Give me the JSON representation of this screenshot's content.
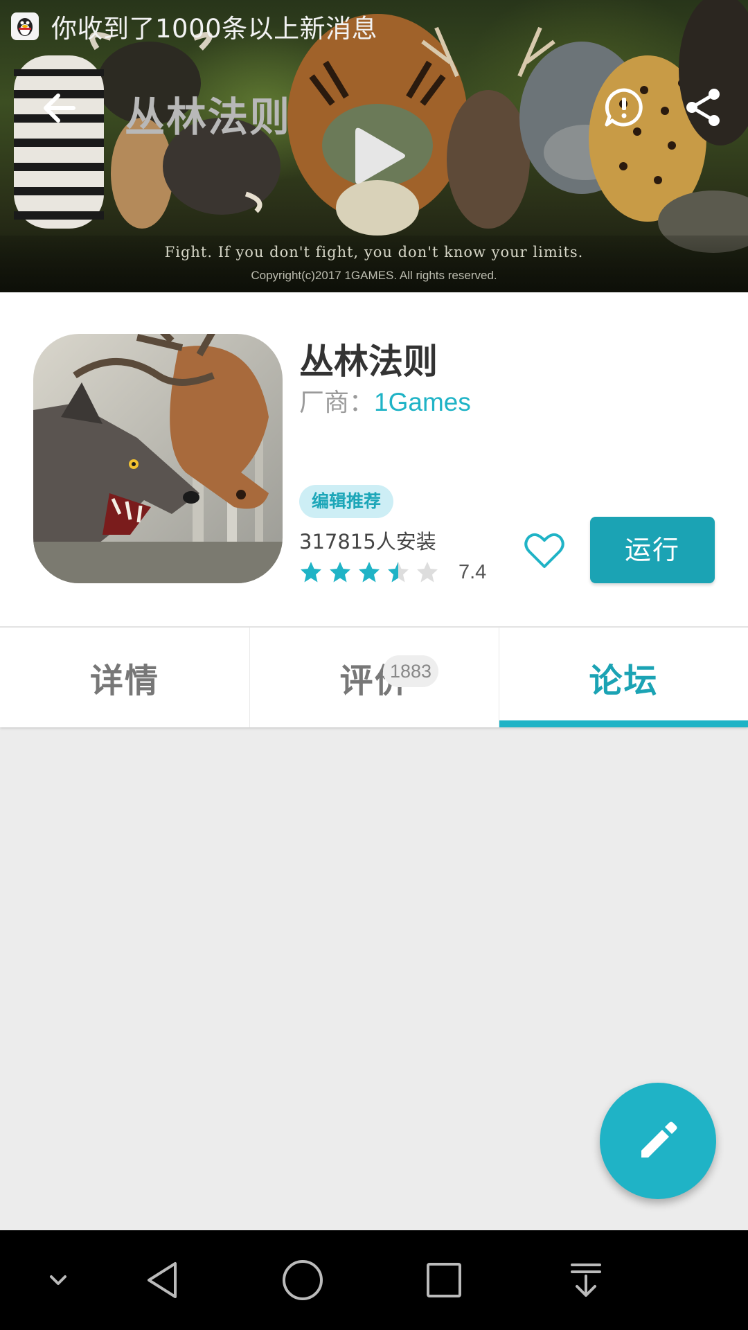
{
  "status_bar": {
    "notification_text": "你收到了1000条以上新消息",
    "notification_icon": "qq-penguin-icon"
  },
  "banner": {
    "title": "丛林法则",
    "slogan": "Fight. If you don't fight, you don't know your limits.",
    "copyright": "Copyright(c)2017 1GAMES. All rights reserved.",
    "actions": [
      "back-arrow-icon",
      "play-icon",
      "report-icon",
      "share-icon"
    ]
  },
  "app": {
    "name": "丛林法则",
    "vendor_label": "厂商：",
    "vendor_name": "1Games",
    "badge": "编辑推荐",
    "installs": "317815人安装",
    "rating": 7.4,
    "rating_text": "7.4",
    "stars": 3.5,
    "favorite_icon": "heart-outline-icon",
    "run_label": "运行"
  },
  "tabs": [
    {
      "label": "详情",
      "active": false
    },
    {
      "label": "评价",
      "count": "1883",
      "active": false
    },
    {
      "label": "论坛",
      "active": true
    }
  ],
  "fab": {
    "icon": "pencil-icon"
  },
  "nav_bar": {
    "buttons": [
      "chevron-down-icon",
      "back-triangle-icon",
      "home-circle-icon",
      "recents-square-icon",
      "notification-pull-icon"
    ]
  },
  "colors": {
    "accent": "#1fb3c6",
    "run_button": "#1ba3b4",
    "badge_bg": "#cdeef5",
    "content_bg": "#ececec"
  }
}
